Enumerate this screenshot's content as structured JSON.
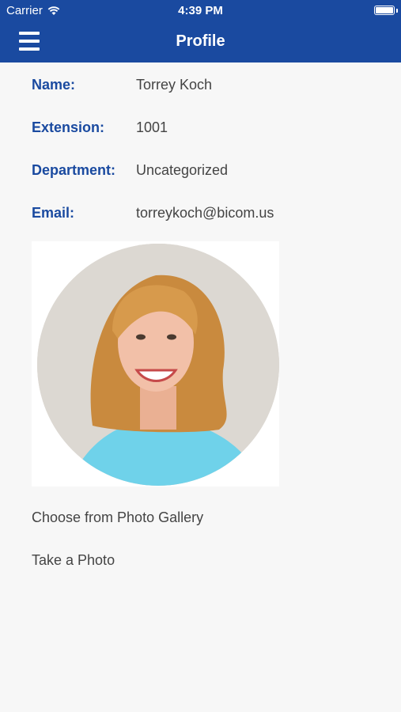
{
  "status_bar": {
    "carrier": "Carrier",
    "time": "4:39 PM",
    "icons": [
      "wifi-icon",
      "battery-icon"
    ]
  },
  "nav": {
    "title": "Profile",
    "menu_icon": "menu-icon"
  },
  "profile": {
    "fields": [
      {
        "label": "Name:",
        "value": "Torrey Koch"
      },
      {
        "label": "Extension:",
        "value": "1001"
      },
      {
        "label": "Department:",
        "value": "Uncategorized"
      },
      {
        "label": "Email:",
        "value": "torreykoch@bicom.us"
      }
    ],
    "photo_icon": "profile-photo"
  },
  "actions": {
    "gallery": "Choose from Photo Gallery",
    "camera": "Take a Photo"
  },
  "colors": {
    "brand": "#1a4aa0",
    "label": "#1a4aa0",
    "value": "#444444",
    "background": "#f7f7f7"
  }
}
